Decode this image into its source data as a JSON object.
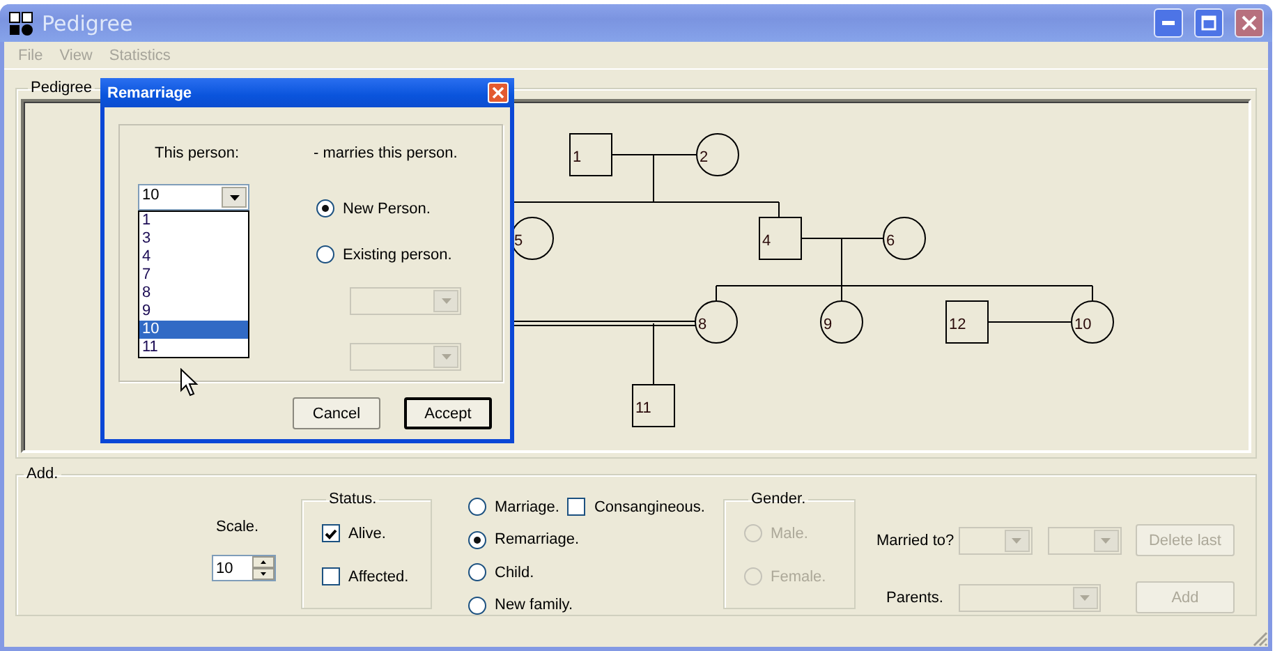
{
  "window": {
    "title": "Pedigree"
  },
  "menu": [
    "File",
    "View",
    "Statistics"
  ],
  "pedigree": {
    "label": "Pedigree",
    "people": [
      {
        "label": "1",
        "kind": "male"
      },
      {
        "label": "2",
        "kind": "female"
      },
      {
        "label": "5",
        "kind": "female"
      },
      {
        "label": "4",
        "kind": "male"
      },
      {
        "label": "6",
        "kind": "female"
      },
      {
        "label": "8",
        "kind": "female"
      },
      {
        "label": "9",
        "kind": "female"
      },
      {
        "label": "12",
        "kind": "male"
      },
      {
        "label": "10",
        "kind": "female"
      },
      {
        "label": "11",
        "kind": "male"
      }
    ]
  },
  "add": {
    "label": "Add.",
    "scale_label": "Scale.",
    "scale_value": "10",
    "status": {
      "label": "Status.",
      "options": [
        {
          "label": "Alive.",
          "checked": true
        },
        {
          "label": "Affected.",
          "checked": false
        }
      ]
    },
    "relations": [
      {
        "label": "Marriage.",
        "selected": false
      },
      {
        "label": "Remarriage.",
        "selected": true
      },
      {
        "label": "Child.",
        "selected": false
      },
      {
        "label": "New family.",
        "selected": false
      }
    ],
    "consanguineous": {
      "label": "Consangineous.",
      "checked": false
    },
    "gender": {
      "label": "Gender.",
      "options": [
        {
          "label": "Male.",
          "selected": false,
          "disabled": true
        },
        {
          "label": "Female.",
          "selected": false,
          "disabled": true
        }
      ]
    },
    "married_to_label": "Married to?",
    "parents_label": "Parents.",
    "buttons": [
      {
        "label": "Delete last",
        "disabled": true
      },
      {
        "label": "Add",
        "disabled": true
      }
    ]
  },
  "dialog": {
    "title": "Remarriage",
    "this_person_label": "This person:",
    "marries_label": "- marries this person.",
    "person_value": "10",
    "person_options": [
      {
        "label": "1",
        "selected": false
      },
      {
        "label": "3",
        "selected": false
      },
      {
        "label": "4",
        "selected": false
      },
      {
        "label": "7",
        "selected": false
      },
      {
        "label": "8",
        "selected": false
      },
      {
        "label": "9",
        "selected": false
      },
      {
        "label": "10",
        "selected": true
      },
      {
        "label": "11",
        "selected": false
      }
    ],
    "choices": [
      {
        "label": "New Person.",
        "selected": true
      },
      {
        "label": "Existing person.",
        "selected": false
      }
    ],
    "buttons": [
      {
        "label": "Cancel",
        "default": false
      },
      {
        "label": "Accept",
        "default": true
      }
    ]
  }
}
